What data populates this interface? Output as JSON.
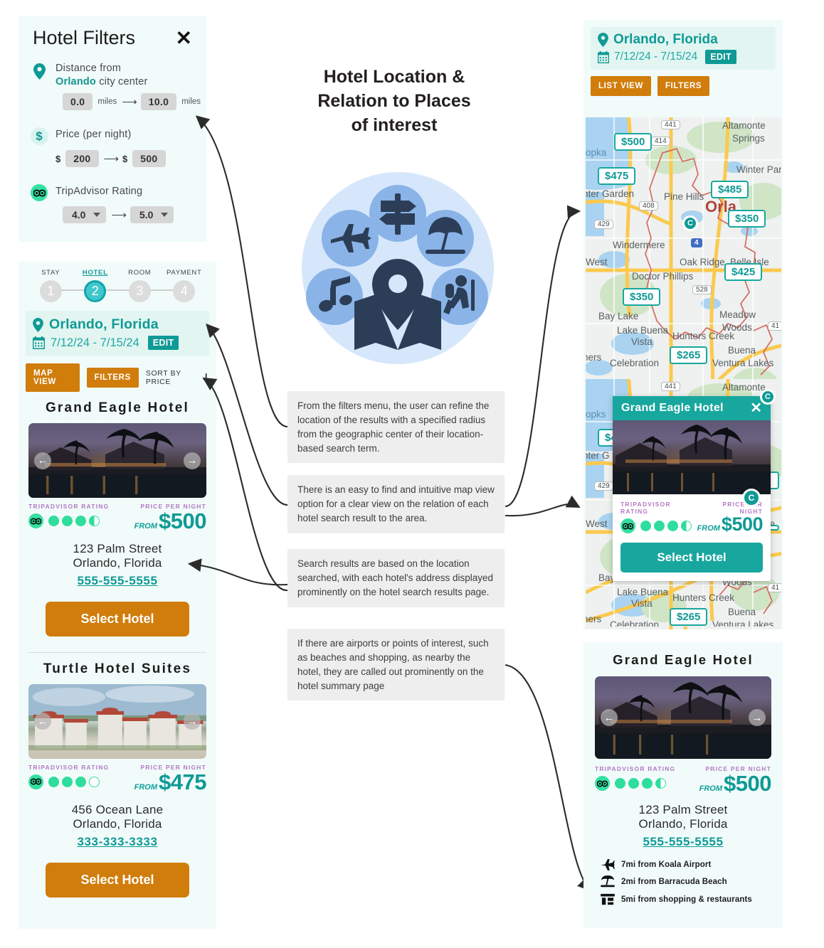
{
  "center": {
    "title": "Hotel Location &\nRelation to Places\nof interest",
    "title_line1": "Hotel Location &",
    "title_line2": "Relation to Places",
    "title_line3": "of interest",
    "hero_icon": "map-with-points-of-interest-icon"
  },
  "notes": [
    "From the filters menu, the user can refine the location of the results with a specified radius from the geographic center of their location-based search term.",
    "There is an easy to find and intuitive map view option for a clear view on the relation of each hotel search result to the area.",
    "Search results are based on the location searched, with each hotel's address displayed prominently on the hotel search results page.",
    "If there are airports or points of interest, such as beaches and shopping, as nearby the hotel, they are called out prominently on the hotel summary page"
  ],
  "filters_panel": {
    "title": "Hotel Filters",
    "close_label": "✕",
    "distance": {
      "label_line1": "Distance from",
      "city": "Orlando",
      "label_line2_rest": " city center",
      "min": "0.0",
      "max": "10.0",
      "unit": "miles",
      "unit2": "miles"
    },
    "price": {
      "label": "Price (per night)",
      "currency": "$",
      "min": "200",
      "max": "500"
    },
    "rating": {
      "label": "TripAdvisor Rating",
      "min": "4.0",
      "max": "5.0"
    }
  },
  "results_panel": {
    "steps": [
      {
        "label": "STAY",
        "num": "1",
        "active": false
      },
      {
        "label": "HOTEL",
        "num": "2",
        "active": true
      },
      {
        "label": "ROOM",
        "num": "3",
        "active": false
      },
      {
        "label": "PAYMENT",
        "num": "4",
        "active": false
      }
    ],
    "location": "Orlando, Florida",
    "dates": "7/12/24 - 7/15/24",
    "edit_label": "EDIT",
    "map_view_label": "MAP VIEW",
    "filters_label": "FILTERS",
    "sort_label": "SORT BY PRICE",
    "hotels": [
      {
        "name": "Grand Eagle Hotel",
        "rating_label": "TRIPADVISOR RATING",
        "rating_dots": [
          1,
          1,
          1,
          1,
          0.5
        ],
        "price_label": "PRICE PER NIGHT",
        "from_label": "FROM",
        "price": "$500",
        "address_line1": "123 Palm Street",
        "address_line2": "Orlando, Florida",
        "phone": "555-555-5555",
        "select_label": "Select Hotel"
      },
      {
        "name": "Turtle Hotel Suites",
        "rating_label": "TRIPADVISOR RATING",
        "rating_dots": [
          1,
          1,
          1,
          0
        ],
        "price_label": "PRICE PER NIGHT",
        "from_label": "FROM",
        "price": "$475",
        "address_line1": "456 Ocean Lane",
        "address_line2": "Orlando, Florida",
        "phone": "333-333-3333",
        "select_label": "Select Hotel"
      }
    ]
  },
  "map_panel": {
    "location": "Orlando, Florida",
    "dates": "7/12/24 - 7/15/24",
    "edit_label": "EDIT",
    "list_view_label": "LIST VIEW",
    "filters_label": "FILTERS",
    "price_pins": [
      "$500",
      "$475",
      "$485",
      "$350",
      "$425",
      "$350",
      "$265"
    ],
    "map_labels": [
      "Altamonte",
      "Springs",
      "Winter Par",
      "Orla",
      "Pine Hills",
      "nter Garden",
      "opka",
      "Windermere",
      "West",
      "Oak Ridge",
      "Belle Isle",
      "Doctor Phillips",
      "Meadow",
      "Woods",
      "Bay Lake",
      "Lake Buena",
      "Vista",
      "Hunters Creek",
      "Buena",
      "Ventura Lakes",
      "Celebration",
      "ners"
    ],
    "road_shields": [
      "441",
      "414",
      "408",
      "429",
      "528",
      "41",
      "4"
    ],
    "center_pin_label": "C"
  },
  "popup": {
    "title": "Grand Eagle Hotel",
    "close_label": "✕",
    "rating_label": "TRIPADVISOR RATING",
    "rating_dots": [
      1,
      1,
      1,
      1,
      0.5
    ],
    "price_label": "PRICE PER NIGHT",
    "from_label": "FROM",
    "price": "$500",
    "select_label": "Select Hotel",
    "cursor_label": "C"
  },
  "summary_panel": {
    "name": "Grand Eagle Hotel",
    "rating_label": "TRIPADVISOR RATING",
    "rating_dots": [
      1,
      1,
      1,
      1,
      0.5
    ],
    "price_label": "PRICE PER NIGHT",
    "from_label": "FROM",
    "price": "$500",
    "address_line1": "123 Palm Street",
    "address_line2": "Orlando, Florida",
    "phone": "555-555-5555",
    "poi": [
      {
        "icon": "airplane-icon",
        "text": "7mi from Koala Airport"
      },
      {
        "icon": "beach-umbrella-icon",
        "text": "2mi from Barracuda Beach"
      },
      {
        "icon": "shop-icon",
        "text": "5mi from shopping & restaurants"
      }
    ]
  },
  "colors": {
    "teal": "#0f9a95",
    "teal_light": "#41c6cb",
    "orange": "#d07d0b",
    "mint_panel": "#f1fbfa",
    "mint_box": "#e2f5f1",
    "rating_green": "#34e0a1",
    "label_purple": "#b379c4",
    "note_bg": "#eeeeee"
  }
}
